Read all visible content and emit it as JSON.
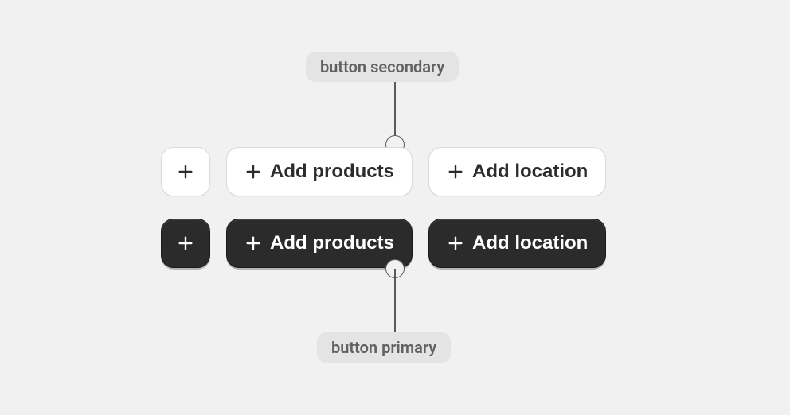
{
  "labels": {
    "top": "button secondary",
    "bottom": "button primary"
  },
  "icons": {
    "plus": "plus-icon"
  },
  "secondary": {
    "icon_only_aria": "Add",
    "add_products": "Add products",
    "add_location": "Add location"
  },
  "primary": {
    "icon_only_aria": "Add",
    "add_products": "Add products",
    "add_location": "Add location"
  }
}
